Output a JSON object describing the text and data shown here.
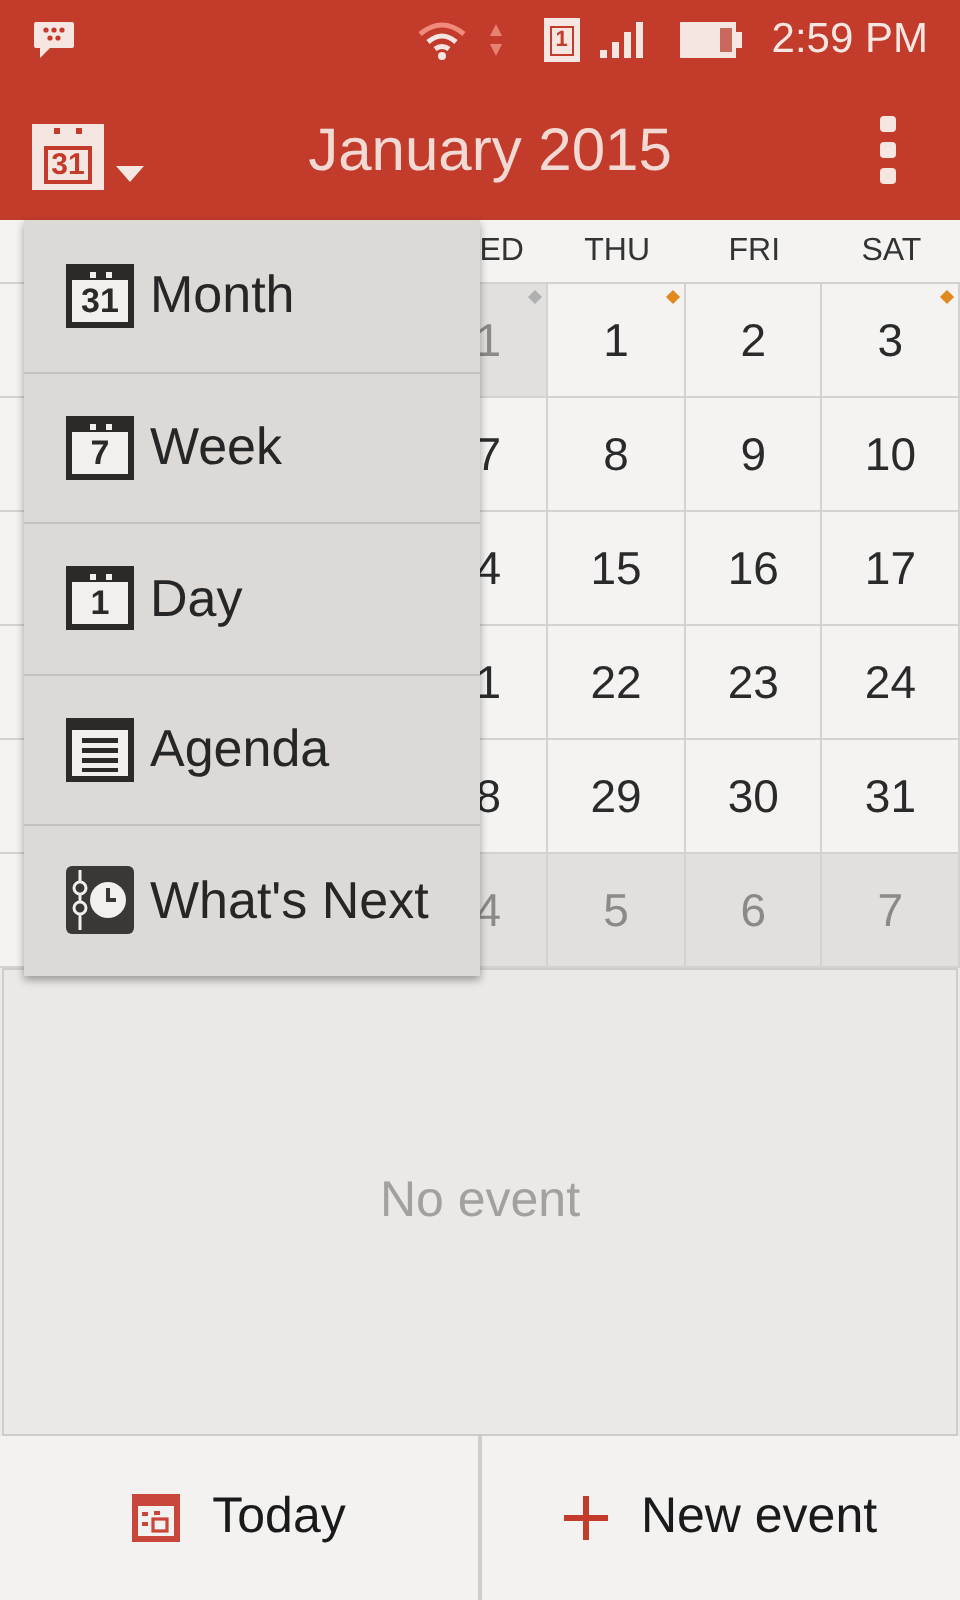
{
  "status_bar": {
    "sim_label": "1",
    "time": "2:59 PM"
  },
  "toolbar": {
    "view_icon_label": "31",
    "title": "January 2015"
  },
  "calendar": {
    "weekdays": [
      "ED",
      "THU",
      "FRI",
      "SAT"
    ],
    "weeks": [
      [
        {
          "day": "1",
          "muted": true,
          "color": "#b0b0b0"
        },
        {
          "day": "1",
          "muted": false,
          "color": "#e08a1e"
        },
        {
          "day": "2",
          "muted": false
        },
        {
          "day": "3",
          "muted": false,
          "color": "#e08a1e"
        }
      ],
      [
        {
          "day": "7",
          "muted": false
        },
        {
          "day": "8",
          "muted": false
        },
        {
          "day": "9",
          "muted": false
        },
        {
          "day": "10",
          "muted": false
        }
      ],
      [
        {
          "day": "4",
          "muted": false
        },
        {
          "day": "15",
          "muted": false
        },
        {
          "day": "16",
          "muted": false
        },
        {
          "day": "17",
          "muted": false
        }
      ],
      [
        {
          "day": "1",
          "muted": false
        },
        {
          "day": "22",
          "muted": false
        },
        {
          "day": "23",
          "muted": false
        },
        {
          "day": "24",
          "muted": false
        }
      ],
      [
        {
          "day": "8",
          "muted": false
        },
        {
          "day": "29",
          "muted": false
        },
        {
          "day": "30",
          "muted": false
        },
        {
          "day": "31",
          "muted": false
        }
      ],
      [
        {
          "day": "4",
          "muted": true
        },
        {
          "day": "5",
          "muted": true
        },
        {
          "day": "6",
          "muted": true
        },
        {
          "day": "7",
          "muted": true
        }
      ]
    ]
  },
  "view_menu": [
    {
      "kind": "month",
      "icon_text": "31",
      "label": "Month"
    },
    {
      "kind": "week",
      "icon_text": "7",
      "label": "Week"
    },
    {
      "kind": "day",
      "icon_text": "1",
      "label": "Day"
    },
    {
      "kind": "agenda",
      "label": "Agenda"
    },
    {
      "kind": "next",
      "label": "What's Next"
    }
  ],
  "events": {
    "empty_text": "No event"
  },
  "bottom_bar": {
    "today": "Today",
    "new_event": "New event"
  }
}
